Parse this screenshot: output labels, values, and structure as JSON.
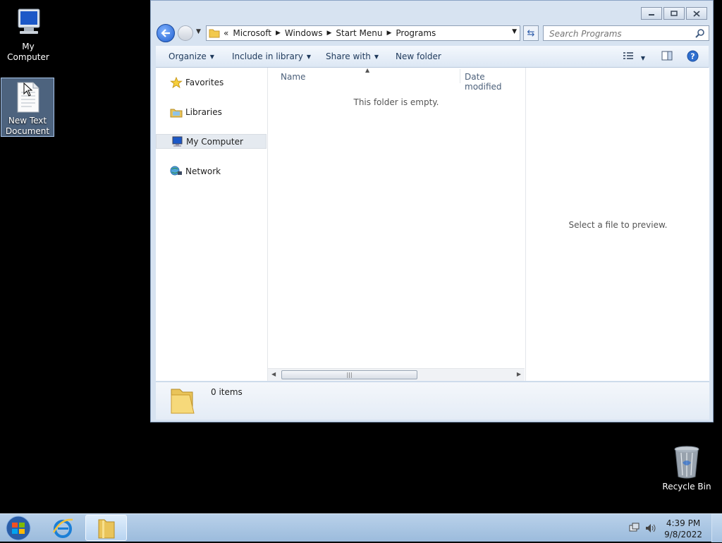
{
  "desktop": {
    "icons": [
      {
        "label": "My Computer"
      },
      {
        "label": "New Text Document"
      },
      {
        "label": "Recycle Bin"
      }
    ]
  },
  "window": {
    "address": {
      "overflow": "«",
      "crumbs": [
        "Microsoft",
        "Windows",
        "Start Menu",
        "Programs"
      ]
    },
    "search": {
      "placeholder": "Search Programs"
    },
    "toolbar": {
      "organize": "Organize",
      "include_in_library": "Include in library",
      "share_with": "Share with",
      "new_folder": "New folder"
    },
    "nav": {
      "favorites": "Favorites",
      "libraries": "Libraries",
      "my_computer": "My Computer",
      "network": "Network"
    },
    "columns": {
      "name": "Name",
      "date_modified": "Date modified"
    },
    "empty_message": "This folder is empty.",
    "preview_message": "Select a file to preview.",
    "details": {
      "item_count": "0 items"
    }
  },
  "taskbar": {
    "clock": {
      "time": "4:39 PM",
      "date": "9/8/2022"
    }
  }
}
